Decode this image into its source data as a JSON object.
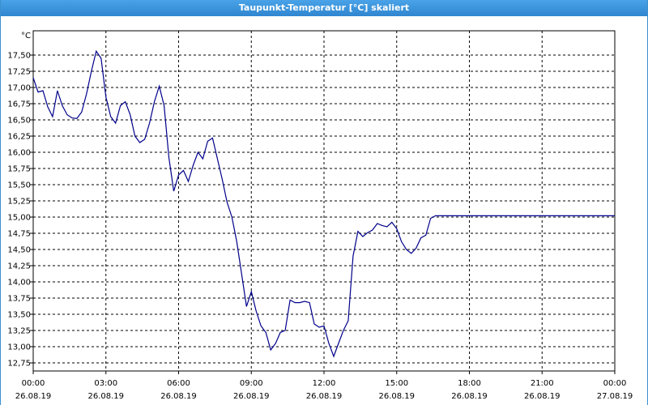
{
  "window": {
    "title": "Taupunkt-Temperatur [°C] skaliert"
  },
  "colors": {
    "line": "#00008b",
    "grid": "#000000",
    "titlebar": "#3b8fd0"
  },
  "chart_data": {
    "type": "line",
    "title": "Taupunkt-Temperatur [°C] skaliert",
    "unit": "°C",
    "xlabel": "",
    "ylabel": "",
    "ylim": [
      12.625,
      17.875
    ],
    "grid": true,
    "y_ticks": [
      "12,75",
      "13,00",
      "13,25",
      "13,50",
      "13,75",
      "14,00",
      "14,25",
      "14,50",
      "14,75",
      "15,00",
      "15,25",
      "15,50",
      "15,75",
      "16,00",
      "16,25",
      "16,50",
      "16,75",
      "17,00",
      "17,25",
      "17,50"
    ],
    "x_ticks": [
      {
        "time": "00:00",
        "date": "26.08.19"
      },
      {
        "time": "03:00",
        "date": "26.08.19"
      },
      {
        "time": "06:00",
        "date": "26.08.19"
      },
      {
        "time": "09:00",
        "date": "26.08.19"
      },
      {
        "time": "12:00",
        "date": "26.08.19"
      },
      {
        "time": "15:00",
        "date": "26.08.19"
      },
      {
        "time": "18:00",
        "date": "26.08.19"
      },
      {
        "time": "21:00",
        "date": "26.08.19"
      },
      {
        "time": "00:00",
        "date": "27.08.19"
      }
    ],
    "series": [
      {
        "time": [
          "26.08.19 00:00",
          "26.08.19 00:12",
          "26.08.19 00:24",
          "26.08.19 00:36",
          "26.08.19 00:48",
          "26.08.19 01:00",
          "26.08.19 01:12",
          "26.08.19 01:24",
          "26.08.19 01:36",
          "26.08.19 01:48",
          "26.08.19 02:00",
          "26.08.19 02:12",
          "26.08.19 02:24",
          "26.08.19 02:36",
          "26.08.19 02:48",
          "26.08.19 03:00",
          "26.08.19 03:12",
          "26.08.19 03:24",
          "26.08.19 03:36",
          "26.08.19 03:48",
          "26.08.19 04:00",
          "26.08.19 04:12",
          "26.08.19 04:24",
          "26.08.19 04:36",
          "26.08.19 04:48",
          "26.08.19 05:00",
          "26.08.19 05:12",
          "26.08.19 05:24",
          "26.08.19 05:36",
          "26.08.19 05:48",
          "26.08.19 06:00",
          "26.08.19 06:12",
          "26.08.19 06:24",
          "26.08.19 06:36",
          "26.08.19 06:48",
          "26.08.19 07:00",
          "26.08.19 07:12",
          "26.08.19 07:24",
          "26.08.19 07:36",
          "26.08.19 07:48",
          "26.08.19 08:00",
          "26.08.19 08:12",
          "26.08.19 08:24",
          "26.08.19 08:36",
          "26.08.19 08:48",
          "26.08.19 09:00",
          "26.08.19 09:12",
          "26.08.19 09:24",
          "26.08.19 09:36",
          "26.08.19 09:48",
          "26.08.19 10:00",
          "26.08.19 10:12",
          "26.08.19 10:24",
          "26.08.19 10:36",
          "26.08.19 10:48",
          "26.08.19 11:00",
          "26.08.19 11:12",
          "26.08.19 11:24",
          "26.08.19 11:36",
          "26.08.19 11:48",
          "26.08.19 12:00",
          "26.08.19 12:12",
          "26.08.19 12:24",
          "26.08.19 12:36",
          "26.08.19 12:48",
          "26.08.19 13:00",
          "26.08.19 13:12",
          "26.08.19 13:24",
          "26.08.19 13:36",
          "26.08.19 13:48",
          "26.08.19 14:00",
          "26.08.19 14:12",
          "26.08.19 14:24",
          "26.08.19 14:36",
          "26.08.19 14:48",
          "26.08.19 15:00",
          "26.08.19 15:12",
          "26.08.19 15:24",
          "26.08.19 15:36",
          "26.08.19 15:48",
          "26.08.19 16:00",
          "26.08.19 16:12",
          "26.08.19 16:24",
          "26.08.19 16:36",
          "26.08.19 16:48",
          "26.08.19 17:00",
          "26.08.19 17:12",
          "26.08.19 17:24",
          "26.08.19 17:36",
          "26.08.19 17:48",
          "26.08.19 18:00",
          "26.08.19 18:12",
          "26.08.19 18:24",
          "26.08.19 18:36",
          "26.08.19 18:48",
          "26.08.19 19:00",
          "26.08.19 19:12",
          "26.08.19 19:24",
          "26.08.19 19:36",
          "26.08.19 19:48",
          "26.08.19 20:00",
          "26.08.19 20:12",
          "26.08.19 20:24",
          "26.08.19 20:36",
          "26.08.19 20:48",
          "26.08.19 21:00",
          "26.08.19 21:12",
          "26.08.19 21:24",
          "26.08.19 21:36",
          "26.08.19 21:48",
          "26.08.19 22:00",
          "26.08.19 22:12",
          "26.08.19 22:24",
          "26.08.19 22:36",
          "26.08.19 22:48",
          "26.08.19 23:00",
          "26.08.19 23:12",
          "26.08.19 23:24",
          "26.08.19 23:36",
          "26.08.19 23:48",
          "27.08.19 00:00"
        ],
        "values": [
          17.15,
          16.93,
          16.95,
          16.7,
          16.55,
          16.95,
          16.72,
          16.58,
          16.53,
          16.52,
          16.62,
          16.9,
          17.25,
          17.56,
          17.45,
          16.85,
          16.55,
          16.45,
          16.72,
          16.78,
          16.58,
          16.25,
          16.15,
          16.2,
          16.45,
          16.78,
          17.02,
          16.72,
          15.92,
          15.4,
          15.65,
          15.72,
          15.55,
          15.8,
          16.0,
          15.9,
          16.17,
          16.22,
          15.9,
          15.58,
          15.23,
          15.0,
          14.62,
          14.12,
          13.62,
          13.85,
          13.55,
          13.32,
          13.22,
          12.95,
          13.05,
          13.22,
          13.25,
          13.72,
          13.68,
          13.68,
          13.7,
          13.68,
          13.35,
          13.3,
          13.32,
          13.05,
          12.85,
          13.05,
          13.25,
          13.4,
          14.4,
          14.78,
          14.7,
          14.76,
          14.8,
          14.9,
          14.87,
          14.85,
          14.92,
          14.82,
          14.62,
          14.5,
          14.44,
          14.52,
          14.68,
          14.72,
          14.98,
          15.02,
          15.02,
          15.02,
          15.02,
          15.02,
          15.02,
          15.02,
          15.02,
          15.02,
          15.02,
          15.02,
          15.02,
          15.02,
          15.02,
          15.02,
          15.02,
          15.02,
          15.02,
          15.02,
          15.02,
          15.02,
          15.02,
          15.02,
          15.02,
          15.02,
          15.02,
          15.02,
          15.02,
          15.02,
          15.02,
          15.02,
          15.02,
          15.02,
          15.02,
          15.02,
          15.02,
          15.02,
          15.02
        ]
      }
    ]
  }
}
